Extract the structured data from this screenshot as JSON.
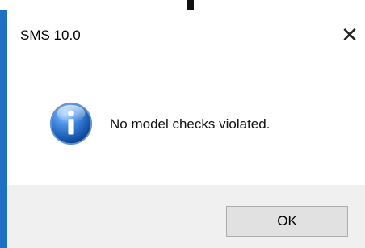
{
  "window": {
    "title": "SMS 10.0",
    "close_glyph": "✕"
  },
  "dialog": {
    "icon": "information-icon",
    "message": "No model checks violated."
  },
  "buttons": {
    "ok_label": "OK"
  },
  "colors": {
    "window_border": "#1f6fc4",
    "footer_bg": "#f0f0f0",
    "button_bg": "#e1e1e1",
    "button_border": "#adadad",
    "info_icon_blue": "#1d5fb8"
  }
}
